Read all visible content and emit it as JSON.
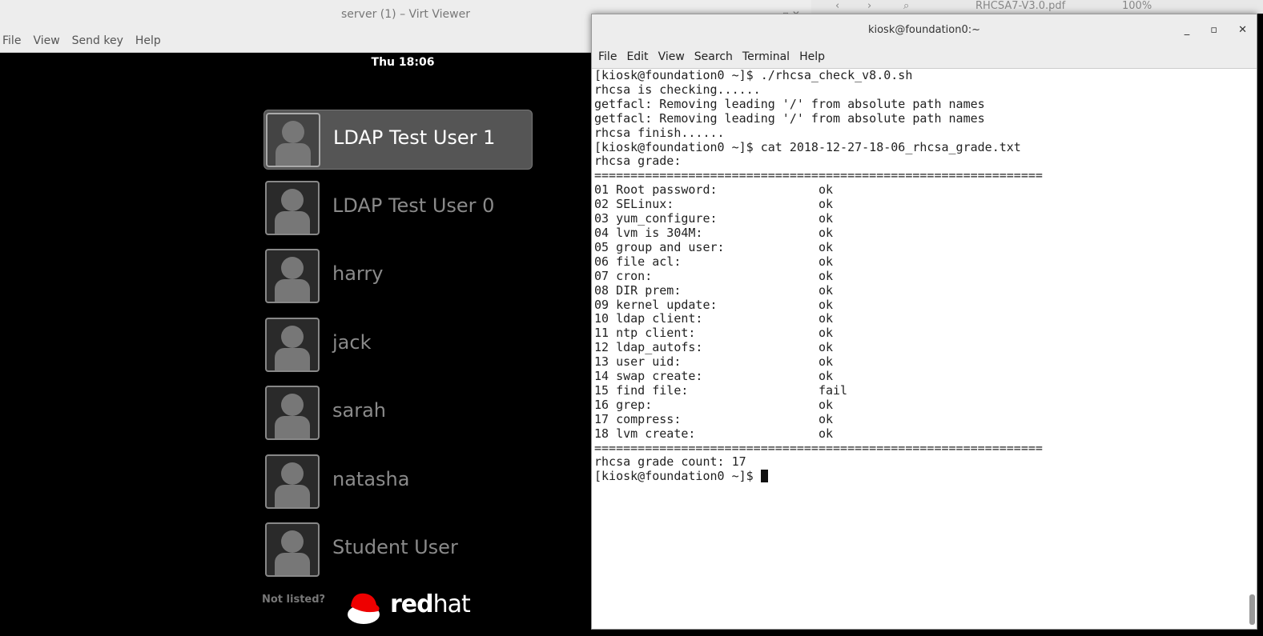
{
  "virt_viewer": {
    "title": "server (1) – Virt Viewer",
    "menu": [
      "File",
      "View",
      "Send key",
      "Help"
    ],
    "clock": "Thu 18:06",
    "users": [
      "LDAP Test User 1",
      "LDAP Test User 0",
      "harry",
      "jack",
      "sarah",
      "natasha",
      "Student User"
    ],
    "not_listed": "Not listed?",
    "logo": "redhat"
  },
  "pdf_toolbar": {
    "filename": "RHCSA7-V3.0.pdf",
    "zoom": "100%"
  },
  "terminal": {
    "title": "kiosk@foundation0:~",
    "menu": [
      "File",
      "Edit",
      "View",
      "Search",
      "Terminal",
      "Help"
    ],
    "lines_before": [
      "[kiosk@foundation0 ~]$ ./rhcsa_check_v8.0.sh",
      "rhcsa is checking......",
      "getfacl: Removing leading '/' from absolute path names",
      "getfacl: Removing leading '/' from absolute path names",
      "rhcsa finish......",
      "[kiosk@foundation0 ~]$ cat 2018-12-27-18-06_rhcsa_grade.txt",
      "rhcsa grade:"
    ],
    "separator": "==============================================================",
    "grades": [
      {
        "label": "01 Root password:",
        "result": "ok"
      },
      {
        "label": "02 SELinux:",
        "result": "ok"
      },
      {
        "label": "03 yum_configure:",
        "result": "ok"
      },
      {
        "label": "04 lvm is 304M:",
        "result": "ok"
      },
      {
        "label": "05 group and user:",
        "result": "ok"
      },
      {
        "label": "06 file acl:",
        "result": "ok"
      },
      {
        "label": "07 cron:",
        "result": "ok"
      },
      {
        "label": "08 DIR prem:",
        "result": "ok"
      },
      {
        "label": "09 kernel update:",
        "result": "ok"
      },
      {
        "label": "10 ldap client:",
        "result": "ok"
      },
      {
        "label": "11 ntp client:",
        "result": "ok"
      },
      {
        "label": "12 ldap_autofs:",
        "result": "ok"
      },
      {
        "label": "13 user uid:",
        "result": "ok"
      },
      {
        "label": "14 swap create:",
        "result": "ok"
      },
      {
        "label": "15 find file:",
        "result": "fail"
      },
      {
        "label": "16 grep:",
        "result": "ok"
      },
      {
        "label": "17 compress:",
        "result": "ok"
      },
      {
        "label": "18 lvm create:",
        "result": "ok"
      }
    ],
    "grade_count": "rhcsa grade count: 17",
    "prompt": "[kiosk@foundation0 ~]$ "
  }
}
